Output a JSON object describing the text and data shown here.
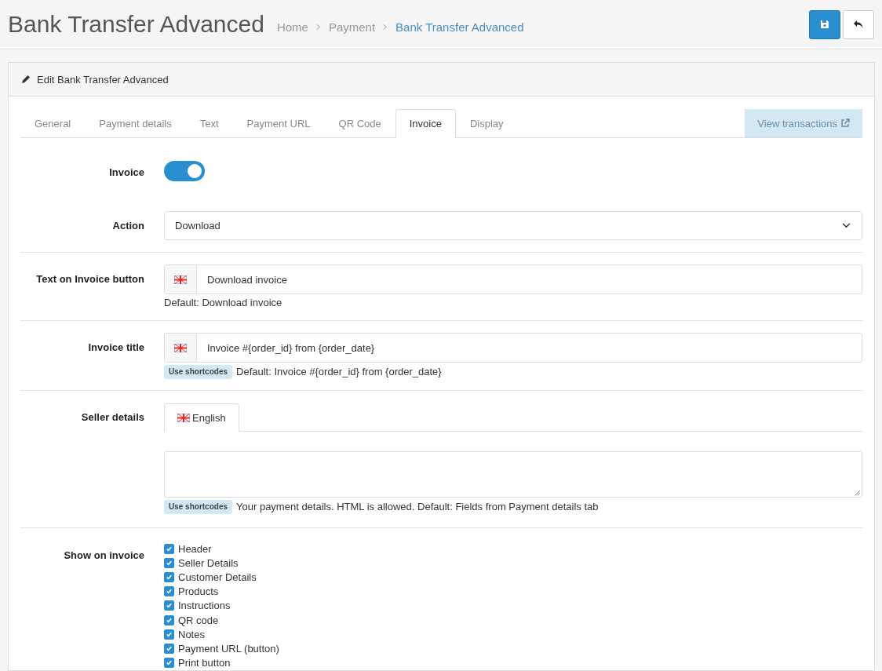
{
  "page_title": "Bank Transfer Advanced",
  "breadcrumb": [
    {
      "text": "Home",
      "current": false
    },
    {
      "text": "Payment",
      "current": false
    },
    {
      "text": "Bank Transfer Advanced",
      "current": true
    }
  ],
  "panel_title": "Edit Bank Transfer Advanced",
  "tabs": [
    {
      "label": "General",
      "selected": false
    },
    {
      "label": "Payment details",
      "selected": false
    },
    {
      "label": "Text",
      "selected": false
    },
    {
      "label": "Payment URL",
      "selected": false
    },
    {
      "label": "QR Code",
      "selected": false
    },
    {
      "label": "Invoice",
      "selected": true
    },
    {
      "label": "Display",
      "selected": false
    }
  ],
  "view_transactions": "View transactions",
  "invoice": {
    "label": "Invoice",
    "on": true
  },
  "action": {
    "label": "Action",
    "value": "Download"
  },
  "text_on_invoice_button": {
    "label": "Text on Invoice button",
    "value": "Download invoice",
    "help": "Default: Download invoice"
  },
  "invoice_title": {
    "label": "Invoice title",
    "value": "Invoice #{order_id} from {order_date}",
    "badge": "Use shortcodes",
    "help": "Default: Invoice #{order_id} from {order_date}"
  },
  "seller_details": {
    "label": "Seller details",
    "language_tab": "English",
    "badge": "Use shortcodes",
    "help": "Your payment details. HTML is allowed. Default: Fields from Payment details tab"
  },
  "show_on_invoice": {
    "label": "Show on invoice",
    "options": [
      {
        "label": "Header",
        "checked": true
      },
      {
        "label": "Seller Details",
        "checked": true
      },
      {
        "label": "Customer Details",
        "checked": true
      },
      {
        "label": "Products",
        "checked": true
      },
      {
        "label": "Instructions",
        "checked": true
      },
      {
        "label": "QR code",
        "checked": true
      },
      {
        "label": "Notes",
        "checked": true
      },
      {
        "label": "Payment URL (button)",
        "checked": true
      },
      {
        "label": "Print button",
        "checked": true
      }
    ]
  }
}
